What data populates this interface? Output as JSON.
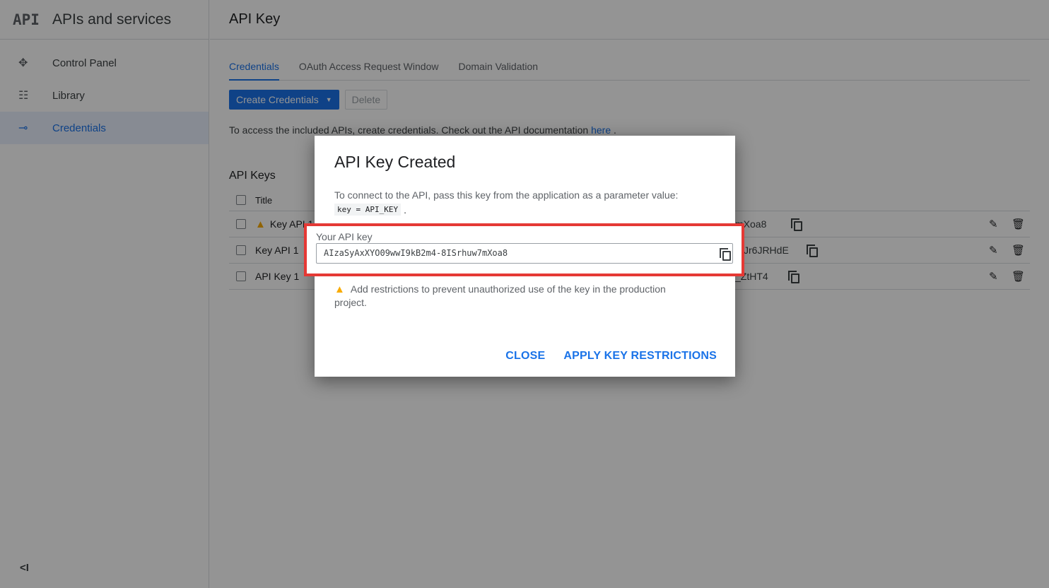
{
  "brand": {
    "logo": "API",
    "title": "APIs and services"
  },
  "sidebar": {
    "items": [
      {
        "label": "Control Panel",
        "icon": "✥"
      },
      {
        "label": "Library",
        "icon": "☷"
      },
      {
        "label": "Credentials",
        "icon": "⊸"
      }
    ],
    "collapse": "<I"
  },
  "header": {
    "title": "API Key"
  },
  "tabs": [
    {
      "label": "Credentials"
    },
    {
      "label": "OAuth Access Request Window"
    },
    {
      "label": "Domain Validation"
    }
  ],
  "toolbar": {
    "create_label": "Create Credentials",
    "delete_label": "Delete"
  },
  "info": {
    "text": "To access the included APIs, create credentials. Check out the API documentation ",
    "link": "here",
    "tail": " ."
  },
  "api_keys": {
    "section_title": "API Keys",
    "column_title": "Title",
    "rows": [
      {
        "name": "Key API 1",
        "key_tail": "mXoa8",
        "warning": true
      },
      {
        "name": "Key API 1",
        "key_tail": "Jr6JRHdE",
        "warning": false
      },
      {
        "name": "API Key 1",
        "key_tail": "_ZtHT4",
        "warning": false
      }
    ]
  },
  "dialog": {
    "title": "API Key Created",
    "description": "To connect to the API, pass this key from the application as a parameter value:",
    "code": "key = API_KEY",
    "code_suffix": ".",
    "key_label": "Your API key",
    "key_value": "AIzaSyAxXYO09wwI9kB2m4-8ISrhuw7mXoa8",
    "warning": "Add restrictions to prevent unauthorized use of the key in the production project.",
    "close_label": "CLOSE",
    "apply_label": "APPLY KEY RESTRICTIONS"
  },
  "colors": {
    "accent": "#1a73e8",
    "highlight": "#e53935",
    "warning": "#f9ab00"
  }
}
